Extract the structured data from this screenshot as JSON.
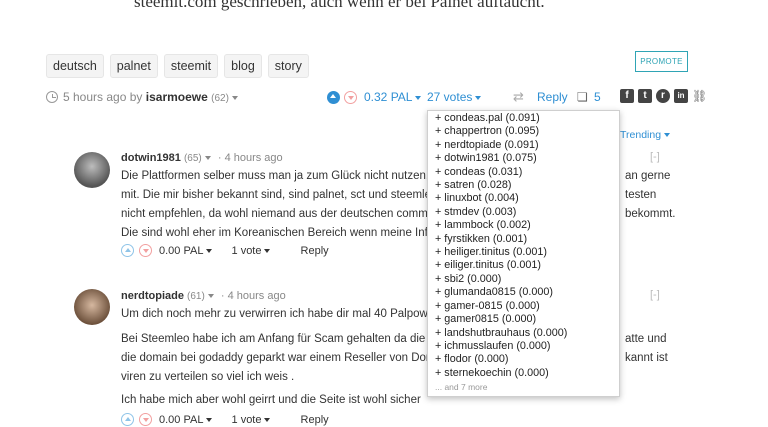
{
  "post": {
    "top_text": "steemit.com geschrieben, auch wenn er bei Palnet auftaucht.",
    "tags": [
      "deutsch",
      "palnet",
      "steemit",
      "blog",
      "story"
    ],
    "promote_label": "PROMOTE",
    "time": "5 hours ago",
    "by_label": "by",
    "author": "isarmoewe",
    "reputation": "(62)",
    "payout": "0.32 PAL",
    "votes_label": "27 votes",
    "reply_label": "Reply",
    "reply_count": "5"
  },
  "social": {
    "facebook": "f",
    "twitter": "t",
    "reddit": "r",
    "linkedin": "in"
  },
  "sort": {
    "label": "Trending"
  },
  "voters_dropdown": {
    "items": [
      "+ condeas.pal (0.091)",
      "+ chappertron (0.095)",
      "+ nerdtopiade (0.091)",
      "+ dotwin1981 (0.075)",
      "+ condeas (0.031)",
      "+ satren (0.028)",
      "+ linuxbot (0.004)",
      "+ stmdev (0.003)",
      "+ lammbock (0.002)",
      "+ fyrstikken (0.001)",
      "+ heiliger.tinitus (0.001)",
      "+ eiliger.tinitus (0.001)",
      "+ sbi2 (0.000)",
      "+ glumanda0815 (0.000)",
      "+ gamer-0815 (0.000)",
      "+ gamer0815 (0.000)",
      "+ landshutbrauhaus (0.000)",
      "+ ichmusslaufen (0.000)",
      "+ flodor (0.000)",
      "+ sternekoechin (0.000)"
    ],
    "more": "... and 7 more"
  },
  "comments": [
    {
      "author": "dotwin1981",
      "reputation": "(65)",
      "time": "4 hours ago",
      "collapse": "[-]",
      "lines": [
        "Die Plattformen selber muss man ja zum Glück nicht nutzen, a",
        "mit. Die mir bisher bekannt sind, sind palnet, sct und steemle",
        "nicht empfehlen, da wohl niemand aus der deutschen commu",
        "Die sind wohl eher im Koreanischen Bereich wenn meine Infos"
      ],
      "lines_right": [
        "an gerne",
        "testen",
        "bekommt.",
        ""
      ],
      "payout": "0.00 PAL",
      "votes": "1 vote",
      "reply": "Reply"
    },
    {
      "author": "nerdtopiade",
      "reputation": "(61)",
      "time": "4 hours ago",
      "collapse": "[-]",
      "lines": [
        "Um dich noch mehr zu verwirren ich habe dir mal 40 Palpowe"
      ],
      "lines2": [
        "Bei Steemleo habe ich am Anfang für Scam gehalten da die we",
        "die domain bei godaddy geparkt war einem Reseller von Dom",
        "viren zu verteilen so viel ich weis ."
      ],
      "lines2_right": [
        "atte und",
        "kannt ist",
        ""
      ],
      "line3": "Ich habe mich aber wohl geirrt und die Seite ist wohl sicher",
      "payout": "0.00 PAL",
      "votes": "1 vote",
      "reply": "Reply"
    }
  ]
}
